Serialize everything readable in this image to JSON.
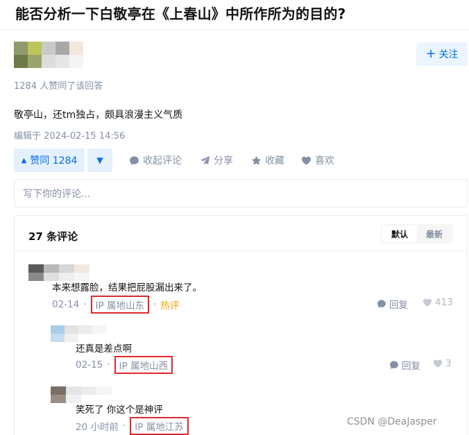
{
  "question": {
    "title": "能否分析一下白敬亭在《上春山》中所作所为的目的?"
  },
  "author": {
    "follow_label": "关注"
  },
  "answer": {
    "voters_text": "1284 人赞同了该回答",
    "content": "敬亭山，还tm独占，颇具浪漫主义气质",
    "edited": "编辑于 2024-02-15 14:56"
  },
  "actions": {
    "vote_up": "赞同 1284",
    "collapse_comments": "收起评论",
    "share": "分享",
    "favorite": "收藏",
    "like": "喜欢"
  },
  "comment_input": {
    "placeholder": "写下你的评论..."
  },
  "comments": {
    "header": "27 条评论",
    "sort_default": "默认",
    "sort_latest": "最新",
    "items": [
      {
        "text": "本来想露脸，结果把屁股漏出来了。",
        "date": "02-14",
        "ip": "IP 属地山东",
        "tag": "热评",
        "reply": "回复",
        "likes": "413"
      },
      {
        "text": "还真是差点啊",
        "date": "02-15",
        "ip": "IP 属地山西",
        "reply": "回复",
        "likes": "3"
      },
      {
        "text": "笑死了 你这个是神评",
        "date": "20 小时前",
        "ip": "IP 属地江苏"
      }
    ]
  },
  "watermark": "CSDN @DeaJasper"
}
